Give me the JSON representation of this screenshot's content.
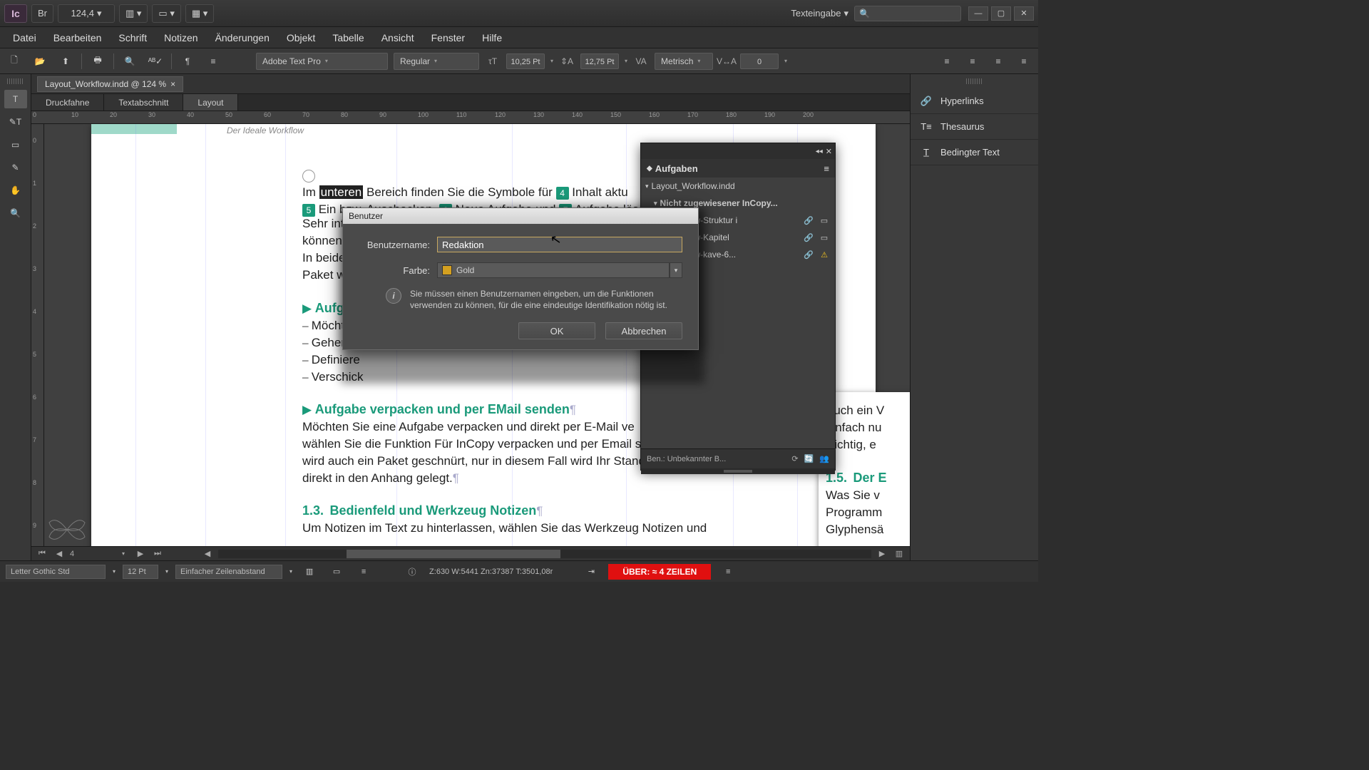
{
  "titlebar": {
    "logo": "Ic",
    "br": "Br",
    "zoom": "124,4",
    "workspace": "Texteingabe"
  },
  "menu": [
    "Datei",
    "Bearbeiten",
    "Schrift",
    "Notizen",
    "Änderungen",
    "Objekt",
    "Tabelle",
    "Ansicht",
    "Fenster",
    "Hilfe"
  ],
  "toolbar": {
    "font": "Adobe Text Pro",
    "style": "Regular",
    "size": "10,25 Pt",
    "leading": "12,75 Pt",
    "kerning": "Metrisch",
    "tracking": "0"
  },
  "doc": {
    "tab": "Layout_Workflow.indd @ 124 %",
    "views": [
      "Druckfahne",
      "Textabschnitt",
      "Layout"
    ],
    "header": "Der Ideale Workflow",
    "para1_pre": "Im ",
    "para1_hl": "unteren",
    "para1_a": " Bereich finden Sie die Symbole für ",
    "m4": "4",
    "para1_b": " Inhalt aktu",
    "m5": "5",
    "para2_a": " Ein bzw. Auschecken, ",
    "m6": "6",
    "para2_b": " Neue Aufgabe und ",
    "m7": "7",
    "para2_c": " Aufgabe lösche",
    "para3": "Sehr inter",
    "para4": "können von",
    "para5": "In beiden Fä",
    "para6": "Paket wiede",
    "h1": "Aufgabe v",
    "l1": "Möchten ",
    "l2": "Gehen Sie",
    "l3": "Definiere",
    "l4": "Verschick",
    "h2": "Aufgabe verpacken und per EMail senden",
    "body2": "Möchten Sie eine Aufgabe verpacken und direkt per E-Mail ve\nwählen Sie die Funktion Für InCopy verpacken und per Email se\nwird auch ein Paket geschnürt, nur in diesem Fall wird Ihr Stand\ndirekt in den Anhang gelegt.",
    "h3_num": "1.3.",
    "h3": "Bedienfeld und Werkzeug Notizen",
    "body3": "Um Notizen im Text zu hinterlassen, wählen Sie das Werkzeug Notizen und",
    "side1": "Auch ein V",
    "side2": "einfach nu",
    "side3": "wichtig, e",
    "h4_num": "1.5.",
    "h4": "Der E",
    "side4": "Was Sie v",
    "side5": "Programm",
    "side6": "Glyphensä"
  },
  "ruler_h": [
    "0",
    "10",
    "20",
    "30",
    "40",
    "50",
    "60",
    "70",
    "80",
    "90",
    "100",
    "110",
    "120",
    "130",
    "140",
    "150",
    "160",
    "170",
    "180",
    "190",
    "200"
  ],
  "ruler_v": [
    "0",
    "1",
    "2",
    "3",
    "4",
    "5",
    "6",
    "7",
    "8",
    "9"
  ],
  "rightpanels": [
    {
      "icon": "link",
      "label": "Hyperlinks"
    },
    {
      "icon": "thes",
      "label": "Thesaurus"
    },
    {
      "icon": "cond",
      "label": "Bedingter Text"
    }
  ],
  "aufgaben": {
    "title": "Aufgaben",
    "file": "Layout_Workflow.indd",
    "group": "Nicht zugewiesener InCopy...",
    "items": [
      "Workflow-Struktur i",
      "Workflow-Kapitel",
      "Workflow-kave-6..."
    ],
    "footer": "Ben.: Unbekannter B..."
  },
  "dialog": {
    "title": "Benutzer",
    "user_label": "Benutzername:",
    "user_value": "Redaktion",
    "color_label": "Farbe:",
    "color_value": "Gold",
    "info": "Sie müssen einen Benutzernamen eingeben, um die Funktionen verwenden zu können, für die eine eindeutige Identifikation nötig ist.",
    "ok": "OK",
    "cancel": "Abbrechen"
  },
  "status": {
    "font": "Letter Gothic Std",
    "size": "12 Pt",
    "spacing": "Einfacher Zeilenabstand",
    "pos": "Z:630    W:5441    Zn:37387   T:3501,08r",
    "overset": "ÜBER:  ≈ 4 ZEILEN"
  },
  "pagenav": {
    "page": "4"
  }
}
